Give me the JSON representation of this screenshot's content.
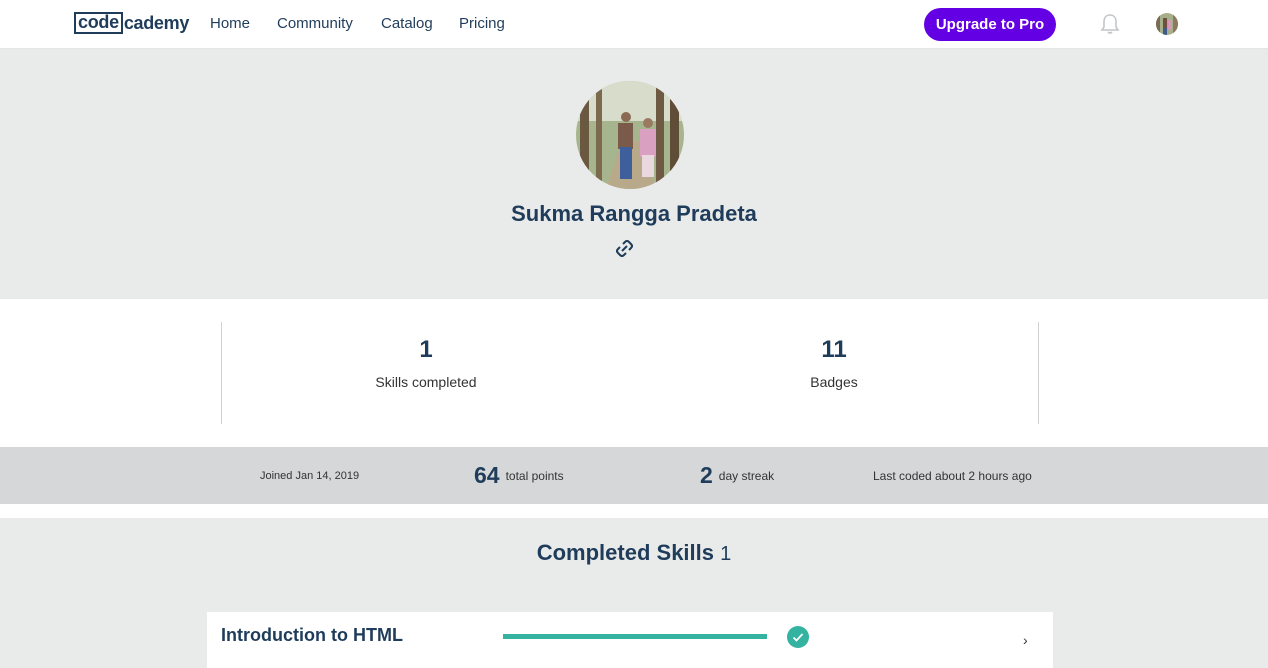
{
  "nav": {
    "logo_box": "code",
    "logo_rest": "cademy",
    "links": [
      "Home",
      "Community",
      "Catalog",
      "Pricing"
    ],
    "upgrade": "Upgrade to Pro",
    "bell_icon": "bell-icon",
    "avatar_icon": "user-avatar"
  },
  "profile": {
    "name": "Sukma Rangga Pradeta",
    "link_icon": "link-icon"
  },
  "stats": [
    {
      "value": "1",
      "label": "Skills completed"
    },
    {
      "value": "11",
      "label": "Badges"
    }
  ],
  "info": {
    "joined": "Joined Jan 14, 2019",
    "points_value": "64",
    "points_label": "total points",
    "streak_value": "2",
    "streak_label": "day streak",
    "last_coded": "Last coded about 2 hours ago"
  },
  "completed": {
    "title": "Completed Skills",
    "count": "1",
    "skills": [
      {
        "name": "Introduction to HTML",
        "progress": 1.0
      }
    ]
  },
  "colors": {
    "accent": "#6400e4",
    "success": "#33b3a0",
    "text": "#1f3c5a"
  }
}
